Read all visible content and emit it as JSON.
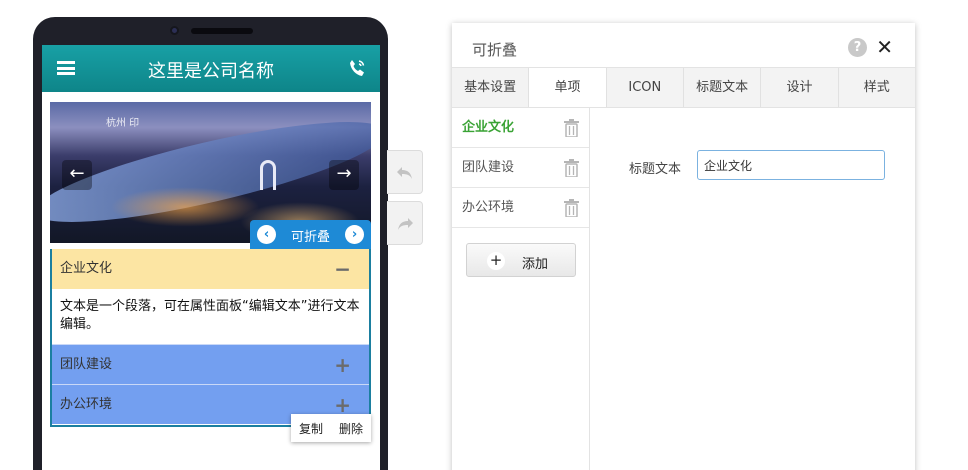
{
  "phone": {
    "app_title": "这里是公司名称",
    "banner_logo": "杭州 印",
    "banner_prev": "←",
    "banner_next": "→",
    "component_tag": "可折叠",
    "tag_prev": "‹",
    "tag_next": "›",
    "accordion": [
      {
        "title": "企业文化",
        "state": "open",
        "sign": "−",
        "content": "文本是一个段落，可在属性面板“编辑文本”进行文本编辑。"
      },
      {
        "title": "团队建设",
        "state": "closed",
        "sign": "+"
      },
      {
        "title": "办公环境",
        "state": "closed",
        "sign": "+"
      }
    ],
    "mini_actions": {
      "copy": "复制",
      "delete": "删除"
    }
  },
  "panel": {
    "title": "可折叠",
    "help": "?",
    "close": "✕",
    "tabs": [
      "基本设置",
      "单项",
      "ICON",
      "标题文本",
      "设计",
      "样式"
    ],
    "active_tab": "单项",
    "items": [
      "企业文化",
      "团队建设",
      "办公环境"
    ],
    "active_item": "企业文化",
    "add_label": "添加",
    "add_plus": "+",
    "field_label": "标题文本",
    "field_value": "企业文化"
  },
  "colors": {
    "header": "#138e92",
    "tag": "#1e8ad6",
    "accordion_open": "#fce5a3",
    "accordion_closed": "#739ff0",
    "active_item": "#3aa335"
  }
}
